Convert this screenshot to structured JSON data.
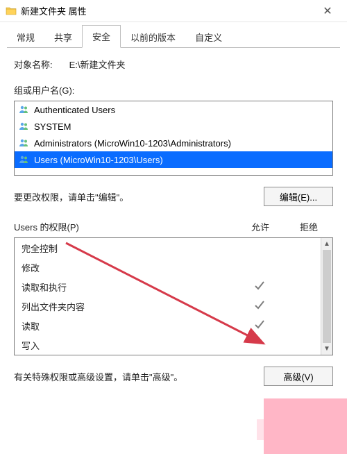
{
  "titlebar": {
    "title": "新建文件夹 属性"
  },
  "tabs": {
    "items": [
      "常规",
      "共享",
      "安全",
      "以前的版本",
      "自定义"
    ],
    "active_index": 2
  },
  "object": {
    "label": "对象名称:",
    "value": "E:\\新建文件夹"
  },
  "groups": {
    "label": "组或用户名(G):",
    "items": [
      {
        "name": "Authenticated Users",
        "selected": false
      },
      {
        "name": "SYSTEM",
        "selected": false
      },
      {
        "name": "Administrators (MicroWin10-1203\\Administrators)",
        "selected": false
      },
      {
        "name": "Users (MicroWin10-1203\\Users)",
        "selected": true
      }
    ]
  },
  "edit": {
    "hint": "要更改权限，请单击\"编辑\"。",
    "button": "编辑(E)..."
  },
  "permissions": {
    "header": "Users 的权限(P)",
    "allow": "允许",
    "deny": "拒绝",
    "rows": [
      {
        "name": "完全控制",
        "allow": false,
        "deny": false
      },
      {
        "name": "修改",
        "allow": false,
        "deny": false
      },
      {
        "name": "读取和执行",
        "allow": true,
        "deny": false
      },
      {
        "name": "列出文件夹内容",
        "allow": true,
        "deny": false
      },
      {
        "name": "读取",
        "allow": true,
        "deny": false
      },
      {
        "name": "写入",
        "allow": false,
        "deny": false
      }
    ]
  },
  "advanced": {
    "hint": "有关特殊权限或高级设置，请单击\"高级\"。",
    "button": "高级(V)"
  }
}
